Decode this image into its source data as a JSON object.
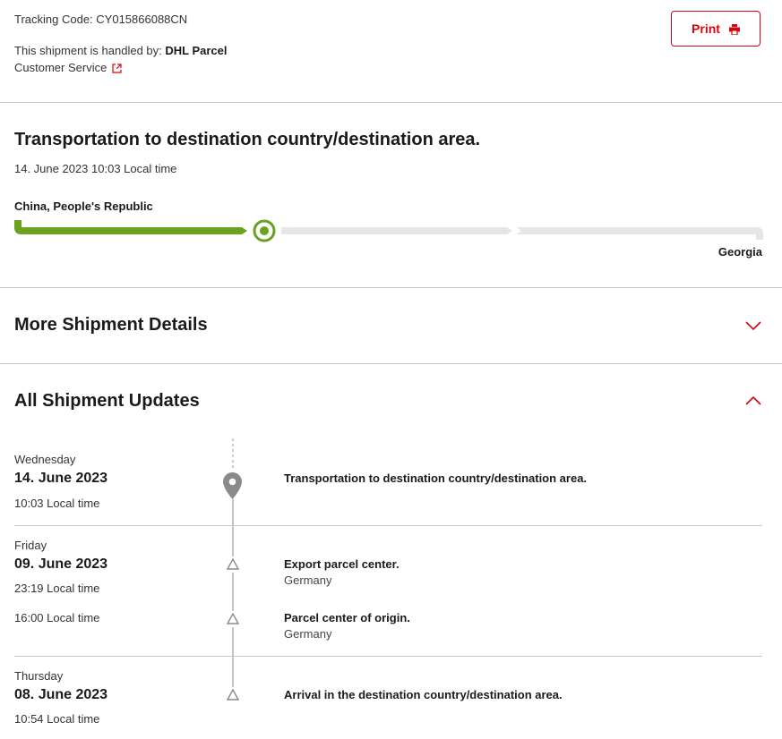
{
  "header": {
    "tracking_code": "Tracking Code: CY015866088CN",
    "handled_prefix": "This shipment is handled by: ",
    "carrier": "DHL Parcel",
    "customer_service": "Customer Service",
    "print_label": "Print"
  },
  "status": {
    "title": "Transportation to destination country/destination area.",
    "timestamp": "14. June 2023 10:03 Local time",
    "origin": "China, People's Republic",
    "destination": "Georgia",
    "progress_fraction": 0.33
  },
  "sections": {
    "more_details": "More Shipment Details",
    "all_updates": "All Shipment Updates"
  },
  "updates": [
    {
      "day": "Wednesday",
      "date": "14. June 2023",
      "events": [
        {
          "time": "10:03 Local time",
          "title": "Transportation to destination country/destination area.",
          "location": ""
        }
      ]
    },
    {
      "day": "Friday",
      "date": "09. June 2023",
      "events": [
        {
          "time": "23:19 Local time",
          "title": "Export parcel center.",
          "location": "Germany"
        },
        {
          "time": "16:00 Local time",
          "title": "Parcel center of origin.",
          "location": "Germany"
        }
      ]
    },
    {
      "day": "Thursday",
      "date": "08. June 2023",
      "events": [
        {
          "time": "10:54 Local time",
          "title": "Arrival in the destination country/destination area.",
          "location": ""
        }
      ]
    }
  ],
  "colors": {
    "accent": "#d40511",
    "progress": "#6aa121",
    "track": "#e6e6e6",
    "marker": "#8a8a8a"
  }
}
